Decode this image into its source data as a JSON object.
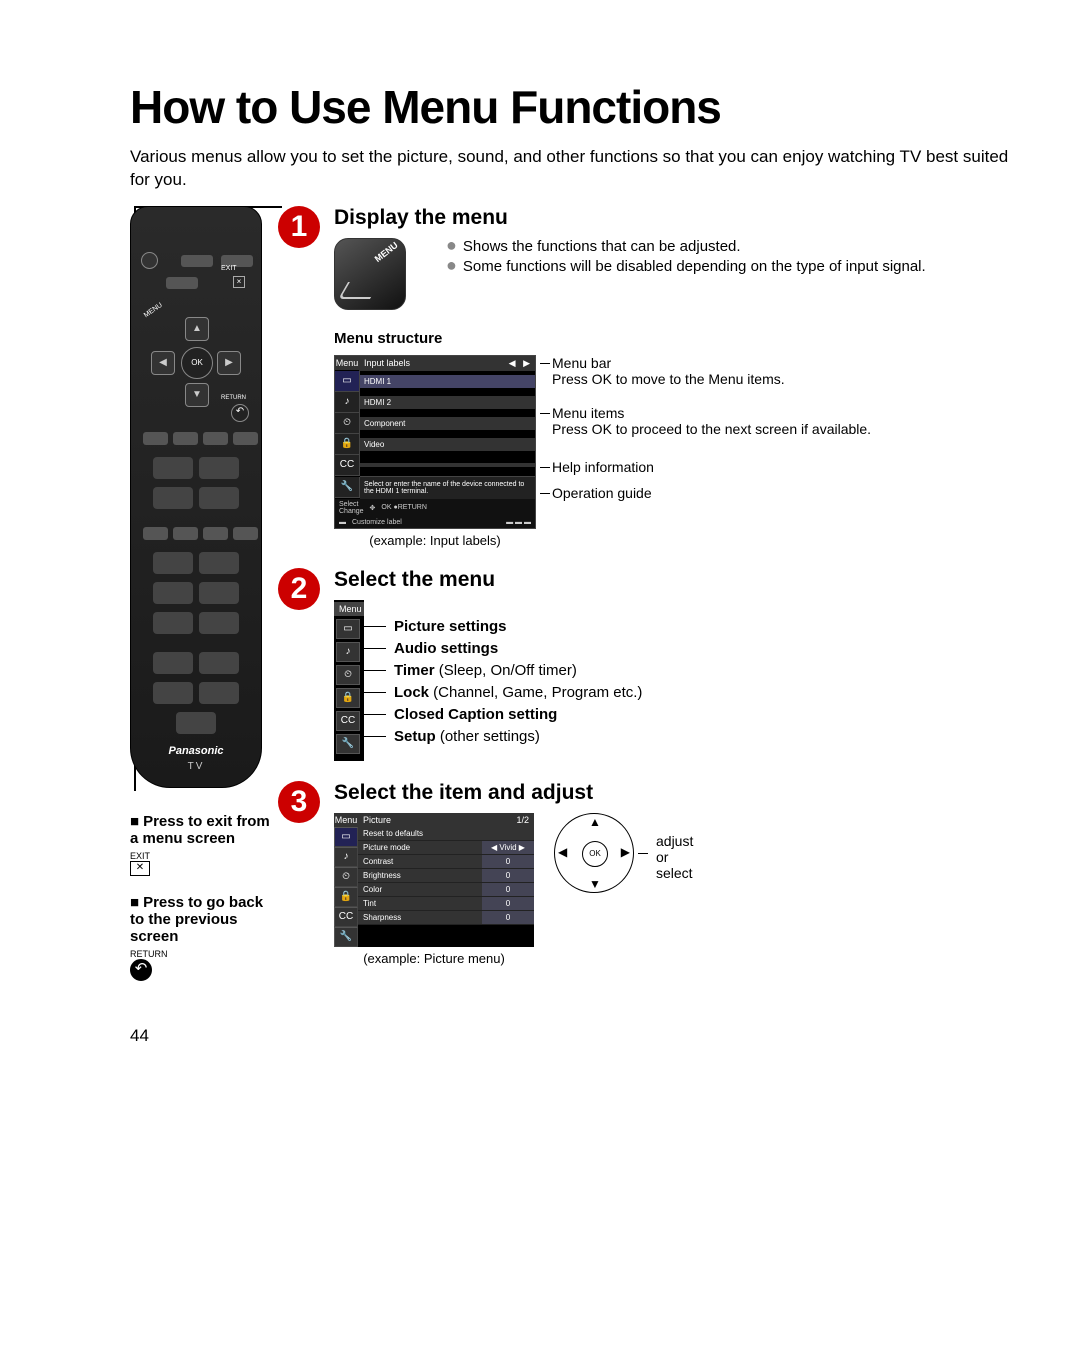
{
  "pageNumber": "44",
  "title": "How to Use Menu Functions",
  "intro": "Various menus allow you to set the picture, sound, and other functions so that you can enjoy watching TV best suited for you.",
  "step1": {
    "title": "Display the menu",
    "menuBtn": "MENU",
    "bullets": [
      "Shows the functions that can be adjusted.",
      "Some functions will be disabled depending on the type of input signal."
    ],
    "structTitle": "Menu structure",
    "screen": {
      "menuLabel": "Menu",
      "panelTitle": "Input labels",
      "rows": [
        "HDMI 1",
        "HDMI 2",
        "Component",
        "Video"
      ],
      "help": "Select or enter the name of the device connected to the HDMI 1 terminal.",
      "guide": {
        "select": "Select",
        "change": "Change",
        "ok": "OK",
        "return": "RETURN",
        "custom": "Customize label"
      }
    },
    "callouts": {
      "menubar": {
        "t": "Menu bar",
        "d": "Press OK to move to the Menu items."
      },
      "menuitems": {
        "t": "Menu items",
        "d": "Press OK to proceed to the next screen if available."
      },
      "help": "Help information",
      "guide": "Operation guide"
    },
    "caption": "(example: Input labels)"
  },
  "step2": {
    "title": "Select the menu",
    "menuLabel": "Menu",
    "items": [
      {
        "b": "Picture settings",
        "r": ""
      },
      {
        "b": "Audio settings",
        "r": ""
      },
      {
        "b": "Timer",
        "r": " (Sleep, On/Off timer)"
      },
      {
        "b": "Lock",
        "r": " (Channel, Game, Program etc.)"
      },
      {
        "b": "Closed Caption setting",
        "r": ""
      },
      {
        "b": "Setup",
        "r": " (other settings)"
      }
    ],
    "icons": [
      "▭",
      "♪",
      "⏲",
      "🔒",
      "CC",
      "🔧"
    ]
  },
  "step3": {
    "title": "Select the item and adjust",
    "screen": {
      "menuLabel": "Menu",
      "panel": "Picture",
      "page": "1/2",
      "rows": [
        {
          "n": "Reset to defaults",
          "v": ""
        },
        {
          "n": "Picture mode",
          "v": "Vivid"
        },
        {
          "n": "Contrast",
          "v": "0"
        },
        {
          "n": "Brightness",
          "v": "0"
        },
        {
          "n": "Color",
          "v": "0"
        },
        {
          "n": "Tint",
          "v": "0"
        },
        {
          "n": "Sharpness",
          "v": "0"
        }
      ]
    },
    "dpad": {
      "ok": "OK",
      "hint": "adjust\nor\nselect"
    },
    "caption": "(example: Picture menu)"
  },
  "sidebar": {
    "exit": {
      "h": "Press to exit from a menu screen",
      "lbl": "EXIT"
    },
    "back": {
      "h": "Press to go back to the previous screen",
      "lbl": "RETURN"
    }
  },
  "remote": {
    "exit": "EXIT",
    "ok": "OK",
    "menu": "MENU",
    "return": "RETURN",
    "brand": "Panasonic",
    "tv": "TV"
  }
}
